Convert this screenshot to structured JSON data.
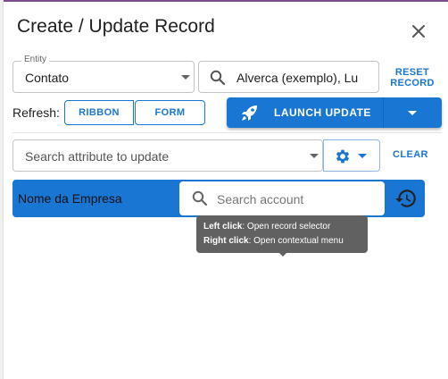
{
  "dialog": {
    "title": "Create / Update Record"
  },
  "entity": {
    "legend": "Entity",
    "value": "Contato"
  },
  "record": {
    "value": "Alverca (exemplo), Lu"
  },
  "reset": {
    "line1": "RESET",
    "line2": "RECORD"
  },
  "refresh": {
    "label": "Refresh:",
    "ribbon": "RIBBON",
    "form": "FORM"
  },
  "launch": {
    "label": "LAUNCH UPDATE"
  },
  "attribute_search": {
    "placeholder": "Search attribute to update",
    "clear": "CLEAR"
  },
  "attribute_row": {
    "name": "Nome da Empresa",
    "account_placeholder": "Search account"
  },
  "tooltip": {
    "left_bold": "Left click",
    "left_text": ": Open record selector",
    "right_bold": "Right click",
    "right_text": ": Open contextual menu"
  },
  "colors": {
    "primary": "#1976d2",
    "tooltip": "#616161",
    "title_bar_accent": "#7b4e8f"
  },
  "icons": [
    "close-icon",
    "search-icon",
    "rocket-icon",
    "chevron-down-icon",
    "gear-icon",
    "history-icon"
  ]
}
